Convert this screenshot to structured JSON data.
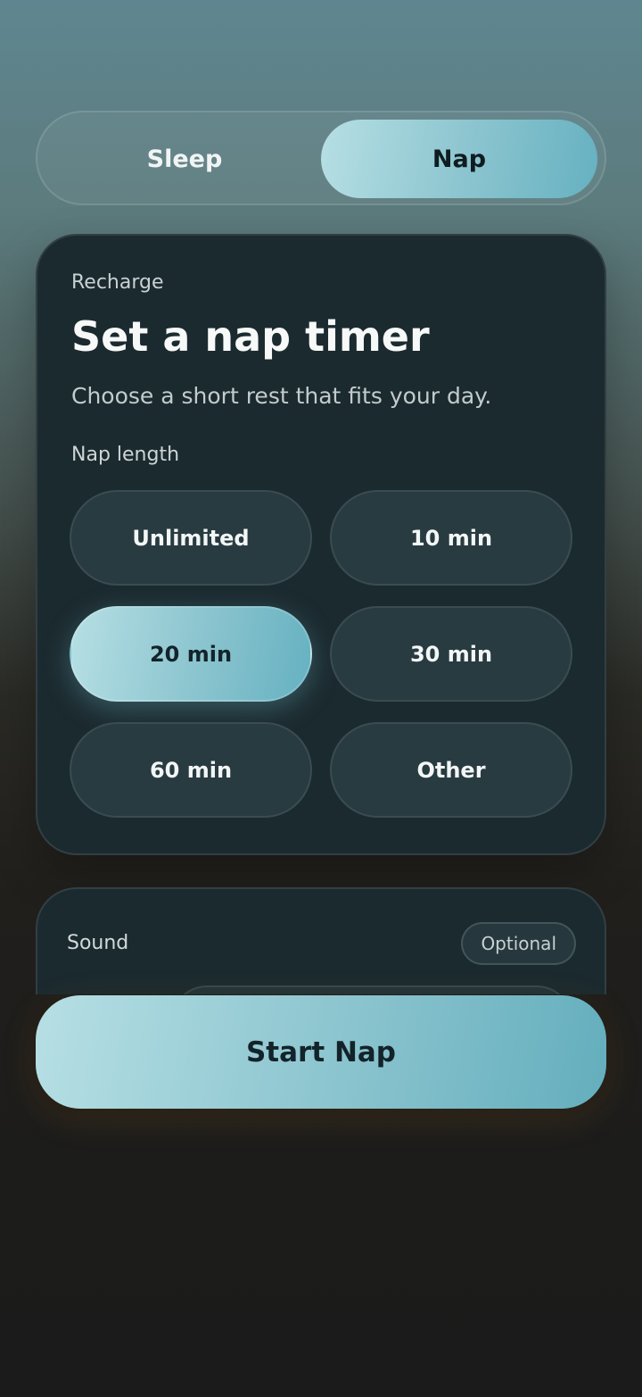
{
  "mode_toggle": {
    "options": [
      {
        "label": "Sleep",
        "selected": false
      },
      {
        "label": "Nap",
        "selected": true
      }
    ]
  },
  "nap_card": {
    "eyebrow": "Recharge",
    "title": "Set a nap timer",
    "subtitle": "Choose a short rest that fits your day.",
    "section_label": "Nap length",
    "options": [
      {
        "label": "Unlimited",
        "selected": false
      },
      {
        "label": "10 min",
        "selected": false
      },
      {
        "label": "20 min",
        "selected": true
      },
      {
        "label": "30 min",
        "selected": false
      },
      {
        "label": "60 min",
        "selected": false
      },
      {
        "label": "Other",
        "selected": false
      }
    ]
  },
  "sound_card": {
    "label": "Sound",
    "badge": "Optional"
  },
  "primary_action": {
    "label": "Start Nap"
  },
  "colors": {
    "accent_gradient_start": "#b6dfe4",
    "accent_gradient_end": "#66b1c1",
    "card_background": "#1b2a2f",
    "option_background": "#283b40"
  }
}
